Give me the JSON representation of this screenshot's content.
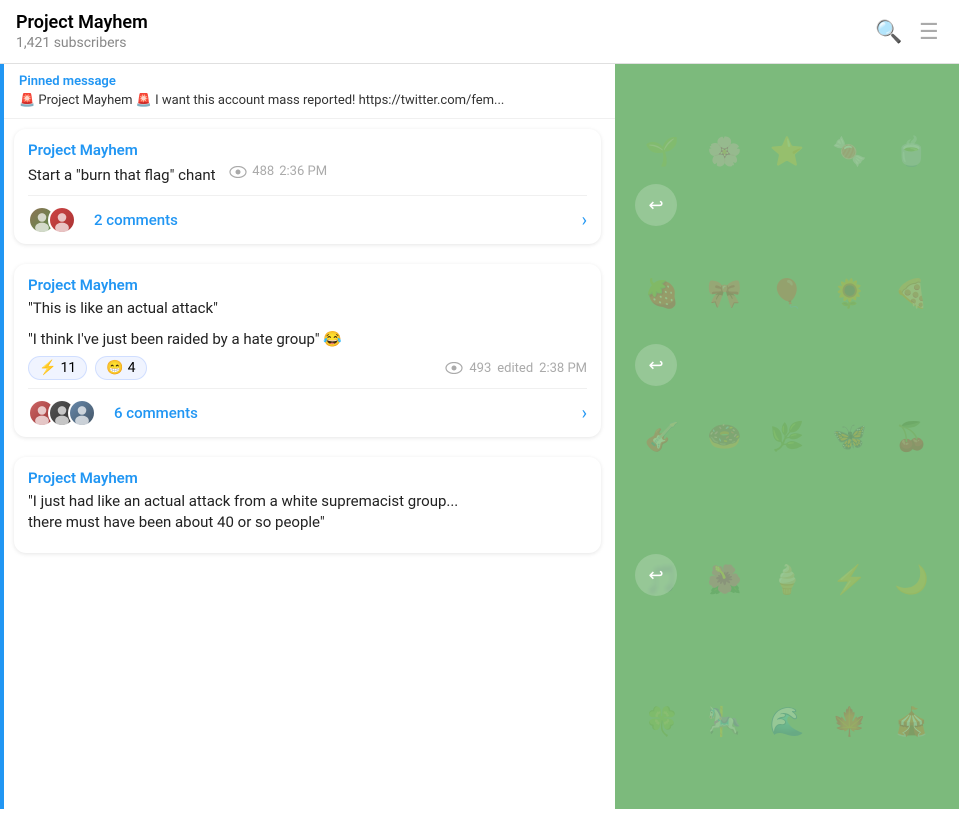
{
  "header": {
    "title": "Project Mayhem",
    "subtitle": "1,421 subscribers",
    "search_icon": "🔍",
    "menu_icon": "☰"
  },
  "pinned": {
    "label": "Pinned message",
    "content": "🚨 Project Mayhem 🚨 I want this account mass reported!  https://twitter.com/fem..."
  },
  "messages": [
    {
      "id": "msg1",
      "sender": "Project Mayhem",
      "text": "Start a \"burn that flag\" chant",
      "views": "488",
      "time": "2:36 PM",
      "edited": false,
      "reactions": [],
      "comments_count": "2 comments",
      "avatars": [
        "👤",
        "👤"
      ]
    },
    {
      "id": "msg2",
      "sender": "Project Mayhem",
      "text_lines": [
        "\"This is like an actual attack\"",
        "",
        "\"I think I've just been raided by a hate group\" 😂"
      ],
      "views": "493",
      "time": "2:38 PM",
      "edited": true,
      "reactions": [
        {
          "emoji": "⚡",
          "count": "11"
        },
        {
          "emoji": "😁",
          "count": "4"
        }
      ],
      "comments_count": "6 comments",
      "avatars": [
        "👤",
        "👤",
        "👤"
      ]
    },
    {
      "id": "msg3",
      "sender": "Project Mayhem",
      "text": "\"I just had like an actual attack from a white supremacist group... there must have been about 40 or so people\"",
      "partial": true,
      "views": "",
      "time": "",
      "edited": false,
      "reactions": [],
      "comments_count": "",
      "avatars": []
    }
  ],
  "deco_items": [
    "🌱",
    "🌸",
    "⭐",
    "🍬",
    "🍵",
    "🍓",
    "🎀",
    "🎈",
    "🌻",
    "🍕",
    "🎸",
    "🍩",
    "🌿",
    "🦋",
    "🍒",
    "🎵",
    "🌺",
    "🍦",
    "⚡",
    "🌙",
    "🍀",
    "🎠",
    "🌊",
    "🍁",
    "🎪"
  ]
}
